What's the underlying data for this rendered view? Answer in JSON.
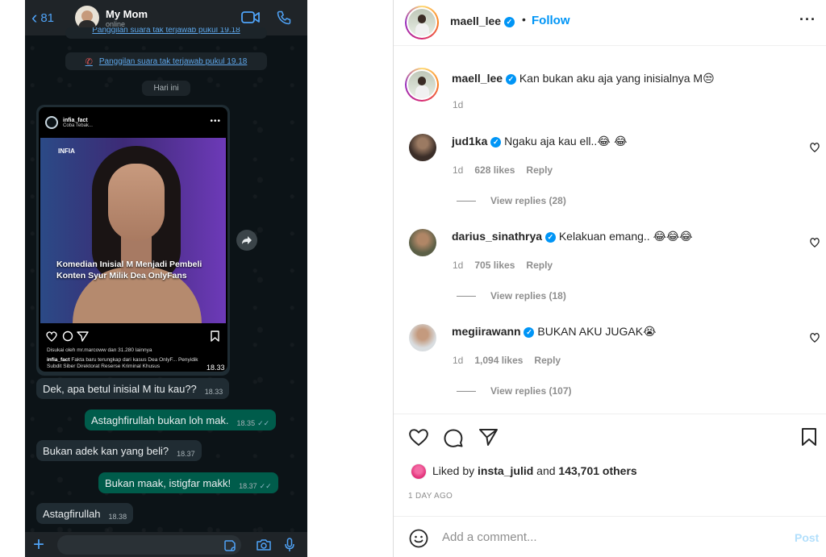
{
  "whatsapp": {
    "back_count": "81",
    "contact_name": "My Mom",
    "contact_status": "online",
    "missed_call_top": "Panggilan suara tak terjawab pukul 19.18",
    "missed_call": "Panggilan suara tak terjawab pukul 19.18",
    "date_chip": "Hari ini",
    "shared_post": {
      "username": "infia_fact",
      "subtitle": "Coba Tebak...",
      "logo": "INFIA",
      "caption": "Komedian Inisial M Menjadi Pembeli Konten Syur Milik Dea OnlyFans",
      "liked_by": "Disukai oleh mr.marcoww dan 31.280 lainnya",
      "text_user": "infia_fact",
      "text": "Fakta baru terungkap dari kasus Dea OnlyF... Penyidik Subdit Siber Direktorat Reserse Kriminal Khusus",
      "time": "18.33"
    },
    "messages": [
      {
        "dir": "in",
        "text": "Dek, apa betul inisial M itu kau??",
        "time": "18.33"
      },
      {
        "dir": "out",
        "text": "Astaghfirullah bukan loh mak.",
        "time": "18.35"
      },
      {
        "dir": "in",
        "text": "Bukan adek kan yang beli?",
        "time": "18.37"
      },
      {
        "dir": "out",
        "text": "Bukan maak, istigfar makk!",
        "time": "18.37"
      },
      {
        "dir": "in",
        "text": "Astagfirullah",
        "time": "18.38"
      }
    ]
  },
  "instagram": {
    "header": {
      "username": "maell_lee",
      "follow": "Follow"
    },
    "caption": {
      "username": "maell_lee",
      "text": "Kan bukan aku aja yang inisialnya M",
      "emoji": "😒",
      "age": "1d"
    },
    "comments": [
      {
        "username": "jud1ka",
        "text": "Ngaku aja kau ell..",
        "emoji": "😂 😂",
        "age": "1d",
        "likes": "628 likes",
        "reply": "Reply",
        "view_replies": "View replies (28)"
      },
      {
        "username": "darius_sinathrya",
        "text": "Kelakuan emang..",
        "emoji": "😂😂😂",
        "age": "1d",
        "likes": "705 likes",
        "reply": "Reply",
        "view_replies": "View replies (18)"
      },
      {
        "username": "megiirawann",
        "text": "BUKAN AKU JUGAK",
        "emoji": "😭",
        "age": "1d",
        "likes": "1,094 likes",
        "reply": "Reply",
        "view_replies": "View replies (107)"
      }
    ],
    "liked_by_prefix": "Liked by",
    "liked_by_user": "insta_julid",
    "liked_by_and": "and",
    "liked_by_count": "143,701 others",
    "date": "1 DAY AGO",
    "comment_placeholder": "Add a comment...",
    "post_label": "Post"
  },
  "colors": {
    "wa_outgoing": "#005c4b",
    "wa_incoming": "#202c33",
    "ig_blue": "#0095f6",
    "wa_link": "#5ea6e9"
  },
  "icons": [
    "chevron-left-icon",
    "video-call-icon",
    "phone-icon",
    "forward-icon",
    "plus-icon",
    "sticker-icon",
    "camera-icon",
    "mic-icon",
    "more-icon",
    "verified-icon",
    "heart-icon",
    "comment-icon",
    "share-icon",
    "bookmark-icon",
    "emoji-icon"
  ]
}
